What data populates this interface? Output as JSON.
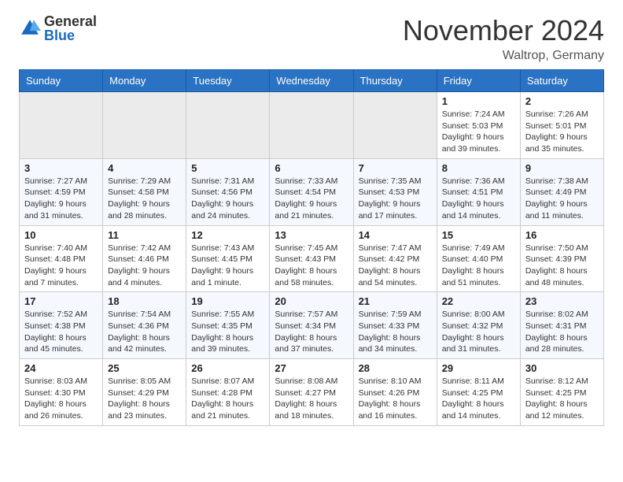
{
  "header": {
    "logo_general": "General",
    "logo_blue": "Blue",
    "month_title": "November 2024",
    "location": "Waltrop, Germany"
  },
  "days_of_week": [
    "Sunday",
    "Monday",
    "Tuesday",
    "Wednesday",
    "Thursday",
    "Friday",
    "Saturday"
  ],
  "weeks": [
    [
      {
        "day": "",
        "info": ""
      },
      {
        "day": "",
        "info": ""
      },
      {
        "day": "",
        "info": ""
      },
      {
        "day": "",
        "info": ""
      },
      {
        "day": "",
        "info": ""
      },
      {
        "day": "1",
        "info": "Sunrise: 7:24 AM\nSunset: 5:03 PM\nDaylight: 9 hours and 39 minutes."
      },
      {
        "day": "2",
        "info": "Sunrise: 7:26 AM\nSunset: 5:01 PM\nDaylight: 9 hours and 35 minutes."
      }
    ],
    [
      {
        "day": "3",
        "info": "Sunrise: 7:27 AM\nSunset: 4:59 PM\nDaylight: 9 hours and 31 minutes."
      },
      {
        "day": "4",
        "info": "Sunrise: 7:29 AM\nSunset: 4:58 PM\nDaylight: 9 hours and 28 minutes."
      },
      {
        "day": "5",
        "info": "Sunrise: 7:31 AM\nSunset: 4:56 PM\nDaylight: 9 hours and 24 minutes."
      },
      {
        "day": "6",
        "info": "Sunrise: 7:33 AM\nSunset: 4:54 PM\nDaylight: 9 hours and 21 minutes."
      },
      {
        "day": "7",
        "info": "Sunrise: 7:35 AM\nSunset: 4:53 PM\nDaylight: 9 hours and 17 minutes."
      },
      {
        "day": "8",
        "info": "Sunrise: 7:36 AM\nSunset: 4:51 PM\nDaylight: 9 hours and 14 minutes."
      },
      {
        "day": "9",
        "info": "Sunrise: 7:38 AM\nSunset: 4:49 PM\nDaylight: 9 hours and 11 minutes."
      }
    ],
    [
      {
        "day": "10",
        "info": "Sunrise: 7:40 AM\nSunset: 4:48 PM\nDaylight: 9 hours and 7 minutes."
      },
      {
        "day": "11",
        "info": "Sunrise: 7:42 AM\nSunset: 4:46 PM\nDaylight: 9 hours and 4 minutes."
      },
      {
        "day": "12",
        "info": "Sunrise: 7:43 AM\nSunset: 4:45 PM\nDaylight: 9 hours and 1 minute."
      },
      {
        "day": "13",
        "info": "Sunrise: 7:45 AM\nSunset: 4:43 PM\nDaylight: 8 hours and 58 minutes."
      },
      {
        "day": "14",
        "info": "Sunrise: 7:47 AM\nSunset: 4:42 PM\nDaylight: 8 hours and 54 minutes."
      },
      {
        "day": "15",
        "info": "Sunrise: 7:49 AM\nSunset: 4:40 PM\nDaylight: 8 hours and 51 minutes."
      },
      {
        "day": "16",
        "info": "Sunrise: 7:50 AM\nSunset: 4:39 PM\nDaylight: 8 hours and 48 minutes."
      }
    ],
    [
      {
        "day": "17",
        "info": "Sunrise: 7:52 AM\nSunset: 4:38 PM\nDaylight: 8 hours and 45 minutes."
      },
      {
        "day": "18",
        "info": "Sunrise: 7:54 AM\nSunset: 4:36 PM\nDaylight: 8 hours and 42 minutes."
      },
      {
        "day": "19",
        "info": "Sunrise: 7:55 AM\nSunset: 4:35 PM\nDaylight: 8 hours and 39 minutes."
      },
      {
        "day": "20",
        "info": "Sunrise: 7:57 AM\nSunset: 4:34 PM\nDaylight: 8 hours and 37 minutes."
      },
      {
        "day": "21",
        "info": "Sunrise: 7:59 AM\nSunset: 4:33 PM\nDaylight: 8 hours and 34 minutes."
      },
      {
        "day": "22",
        "info": "Sunrise: 8:00 AM\nSunset: 4:32 PM\nDaylight: 8 hours and 31 minutes."
      },
      {
        "day": "23",
        "info": "Sunrise: 8:02 AM\nSunset: 4:31 PM\nDaylight: 8 hours and 28 minutes."
      }
    ],
    [
      {
        "day": "24",
        "info": "Sunrise: 8:03 AM\nSunset: 4:30 PM\nDaylight: 8 hours and 26 minutes."
      },
      {
        "day": "25",
        "info": "Sunrise: 8:05 AM\nSunset: 4:29 PM\nDaylight: 8 hours and 23 minutes."
      },
      {
        "day": "26",
        "info": "Sunrise: 8:07 AM\nSunset: 4:28 PM\nDaylight: 8 hours and 21 minutes."
      },
      {
        "day": "27",
        "info": "Sunrise: 8:08 AM\nSunset: 4:27 PM\nDaylight: 8 hours and 18 minutes."
      },
      {
        "day": "28",
        "info": "Sunrise: 8:10 AM\nSunset: 4:26 PM\nDaylight: 8 hours and 16 minutes."
      },
      {
        "day": "29",
        "info": "Sunrise: 8:11 AM\nSunset: 4:25 PM\nDaylight: 8 hours and 14 minutes."
      },
      {
        "day": "30",
        "info": "Sunrise: 8:12 AM\nSunset: 4:25 PM\nDaylight: 8 hours and 12 minutes."
      }
    ]
  ]
}
